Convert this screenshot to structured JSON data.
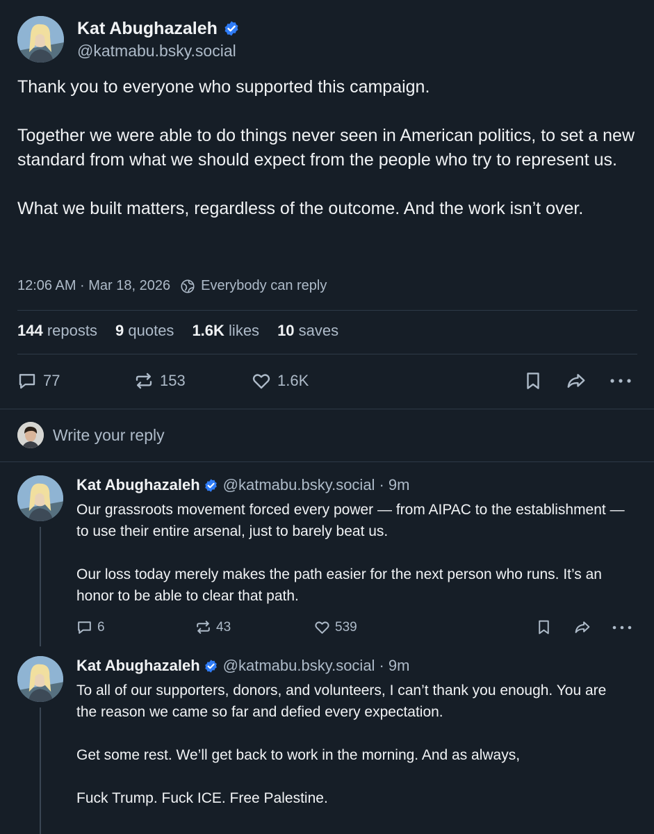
{
  "post": {
    "author_name": "Kat Abughazaleh",
    "handle": "@katmabu.bsky.social",
    "paragraphs": [
      "Thank you to everyone who supported this campaign.",
      "Together we were able to do things never seen in American politics, to set a new standard from what we should expect from the people who try to represent us.",
      "What we built matters, regardless of the outcome. And the work isn’t over."
    ],
    "timestamp": "12:06 AM · Mar 18, 2026",
    "reply_setting": "Everybody can reply",
    "stats": {
      "reposts_count": "144",
      "reposts_label": "reposts",
      "quotes_count": "9",
      "quotes_label": "quotes",
      "likes_count": "1.6K",
      "likes_label": "likes",
      "saves_count": "10",
      "saves_label": "saves"
    },
    "actions": {
      "replies": "77",
      "reposts": "153",
      "likes": "1.6K"
    }
  },
  "composer": {
    "placeholder": "Write your reply"
  },
  "replies": [
    {
      "author_name": "Kat Abughazaleh",
      "handle": "@katmabu.bsky.social",
      "time": "· 9m",
      "paragraphs": [
        "Our grassroots movement forced every power — from AIPAC to the establishment — to use their entire arsenal, just to barely beat us.",
        "Our loss today merely makes the path easier for the next person who runs. It’s an honor to be able to clear that path."
      ],
      "actions": {
        "replies": "6",
        "reposts": "43",
        "likes": "539"
      }
    },
    {
      "author_name": "Kat Abughazaleh",
      "handle": "@katmabu.bsky.social",
      "time": "· 9m",
      "paragraphs": [
        "To all of our supporters, donors, and volunteers, I can’t thank you enough. You are the reason we came so far and defied every expectation.",
        "Get some rest. We’ll get back to work in the morning. And as always,",
        "Fuck Trump. Fuck ICE. Free Palestine."
      ]
    }
  ],
  "colors": {
    "background": "#161e27",
    "text": "#f1f3f5",
    "muted_text": "#aebbc9",
    "verified_badge": "#2f7cf6",
    "divider": "#2e3a47"
  },
  "icons": [
    "verified-badge-icon",
    "globe-icon",
    "reply-icon",
    "repost-icon",
    "like-icon",
    "bookmark-icon",
    "share-icon",
    "more-icon"
  ]
}
